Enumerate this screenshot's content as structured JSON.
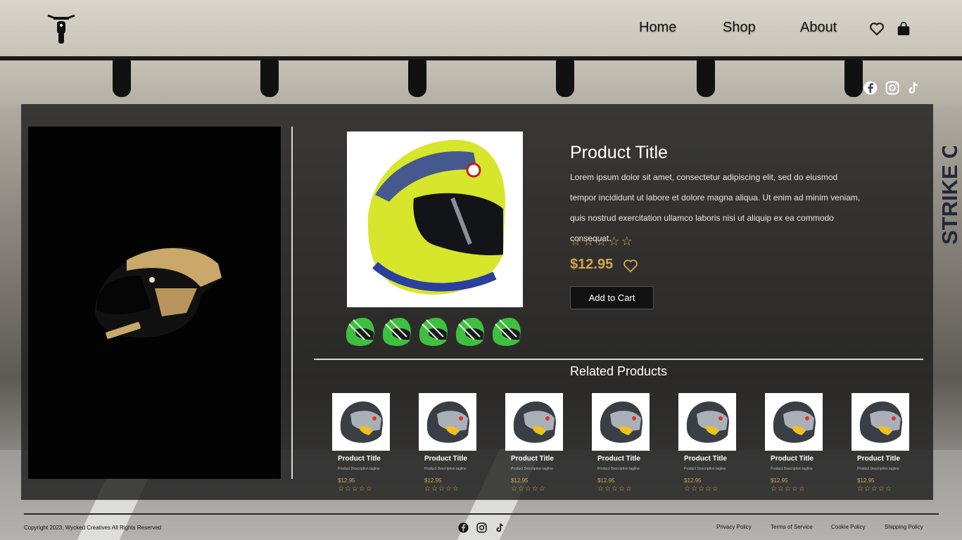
{
  "nav": {
    "home": "Home",
    "shop": "Shop",
    "about": "About"
  },
  "brand_vertical": "STRIKE O",
  "product": {
    "title": "Product Title",
    "description": "Lorem ipsum dolor sit amet, consectetur adipiscing elit, sed do eiusmod tempor incididunt ut labore et dolore magna aliqua. Ut enim ad minim veniam, quis nostrud exercitation ullamco laboris nisi ut aliquip ex ea commodo consequat.",
    "price": "$12.95",
    "rating": 0,
    "add_to_cart": "Add to Cart"
  },
  "related": {
    "title": "Related Products",
    "items": [
      {
        "title": "Product Title",
        "tagline": "Product Description tagline",
        "price": "$12.95"
      },
      {
        "title": "Product Title",
        "tagline": "Product Description tagline",
        "price": "$12.95"
      },
      {
        "title": "Product Title",
        "tagline": "Product Description tagline",
        "price": "$12.95"
      },
      {
        "title": "Product Title",
        "tagline": "Product Description tagline",
        "price": "$12.95"
      },
      {
        "title": "Product Title",
        "tagline": "Product Description tagline",
        "price": "$12.95"
      },
      {
        "title": "Product Title",
        "tagline": "Product Description tagline",
        "price": "$12.95"
      },
      {
        "title": "Product Title",
        "tagline": "Product Description tagline",
        "price": "$12.95"
      }
    ]
  },
  "footer": {
    "copyright": "Copyright 2023, Wycked Creatives All Rights Reserved",
    "privacy": "Privacy Policy",
    "terms": "Terms of Service",
    "cookie": "Cookie Policy",
    "shipping": "Shipping Policy"
  },
  "icons": {
    "logo": "motorcycle-icon",
    "wishlist": "heart-icon",
    "cart": "shopping-bag-icon",
    "social": [
      "facebook-icon",
      "instagram-icon",
      "tiktok-icon"
    ]
  },
  "colors": {
    "accent": "#d6a64a",
    "panel": "#1e1e1e",
    "helmet_main": "#d7e62a",
    "helmet_thumb": "#3fbf3f"
  }
}
